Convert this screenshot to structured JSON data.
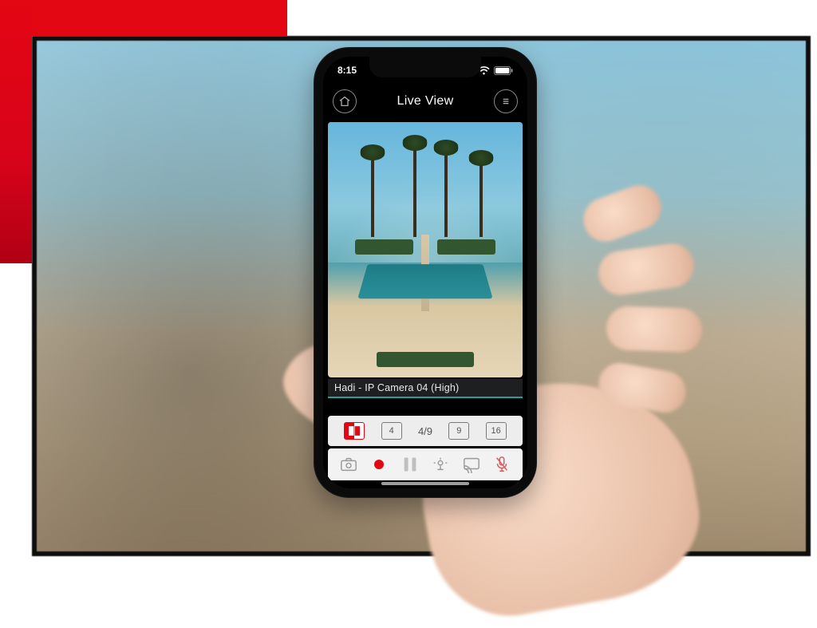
{
  "status": {
    "time": "8:15"
  },
  "header": {
    "title": "Live View"
  },
  "feed": {
    "label": "Hadi - IP Camera 04 (High)"
  },
  "layouts": {
    "single": "1",
    "four": "4",
    "ratio": "4/9",
    "nine": "9",
    "sixteen": "16"
  }
}
